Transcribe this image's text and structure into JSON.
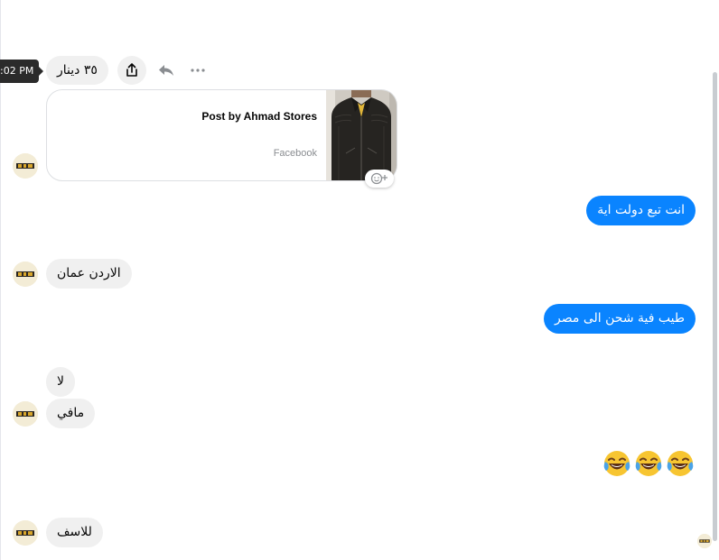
{
  "tooltip": {
    "time": ":02 PM"
  },
  "shared_post": {
    "price": "٣٥ دينار",
    "title": "Post by Ahmad Stores",
    "source": "Facebook"
  },
  "actions": {
    "share_icon": "share-icon",
    "reply_icon": "reply-icon",
    "more_icon": "more-options-icon",
    "react_icon": "add-reaction-icon"
  },
  "messages": [
    {
      "direction": "outgoing",
      "text": "انت تبع دولت اية"
    },
    {
      "direction": "incoming",
      "text": "الاردن عمان"
    },
    {
      "direction": "outgoing",
      "text": "طيب فية شحن الى مصر"
    },
    {
      "direction": "incoming",
      "text": "لا"
    },
    {
      "direction": "incoming",
      "text": "مافي"
    },
    {
      "direction": "outgoing",
      "emoji": [
        "face-with-tears-of-joy",
        "face-with-tears-of-joy",
        "face-with-tears-of-joy"
      ]
    },
    {
      "direction": "incoming",
      "text": "للاسف"
    }
  ],
  "colors": {
    "outgoing_bubble": "#0a84ff",
    "incoming_bubble": "#f0f0f0",
    "tooltip_bg": "#2b2b2b"
  }
}
